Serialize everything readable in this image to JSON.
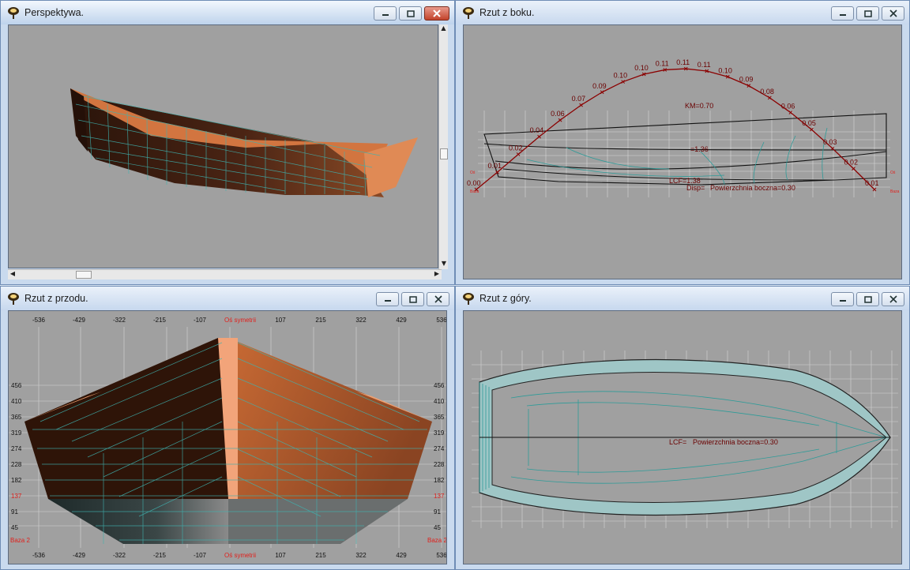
{
  "windows": {
    "perspective": {
      "title": "Perspektywa."
    },
    "side": {
      "title": "Rzut z boku.",
      "curve_labels": [
        "0.00",
        "0.01",
        "0.02",
        "0.04",
        "0.06",
        "0.07",
        "0.09",
        "0.10",
        "0.10",
        "0.11",
        "0.11",
        "0.11",
        "0.10",
        "0.09",
        "0.08",
        "0.06",
        "0.05",
        "0.03",
        "0.02",
        "0.01"
      ],
      "km_label": "KM=0.70",
      "mid_label": "=1.36",
      "lcf_label": "LCF=1.38",
      "disp_label": "Disp=",
      "area_label": "Powierzchnia boczna=0.30"
    },
    "front": {
      "title": "Rzut z przodu.",
      "x_labels": [
        "-536",
        "-429",
        "-322",
        "-215",
        "-107",
        "Oś symetrii",
        "107",
        "215",
        "322",
        "429",
        "536"
      ],
      "y_labels": [
        "456",
        "410",
        "365",
        "319",
        "274",
        "228",
        "182",
        "137",
        "91",
        "45"
      ],
      "base_label": "Baza 2"
    },
    "top": {
      "title": "Rzut z góry.",
      "lcf_label": "LCF=",
      "area_label": "Powierzchnia boczna=0.30"
    }
  },
  "colors": {
    "red_label": "#e0201c",
    "curve": "#8b0000",
    "mesh": "#3fb3b0",
    "hull_dark": "#3a1c10",
    "hull_light": "#d9773d",
    "viewport": "#a0a0a0"
  },
  "icons": {
    "app": "app-pin-icon",
    "minimize": "minimize-icon",
    "maximize": "maximize-icon",
    "close": "close-icon"
  }
}
